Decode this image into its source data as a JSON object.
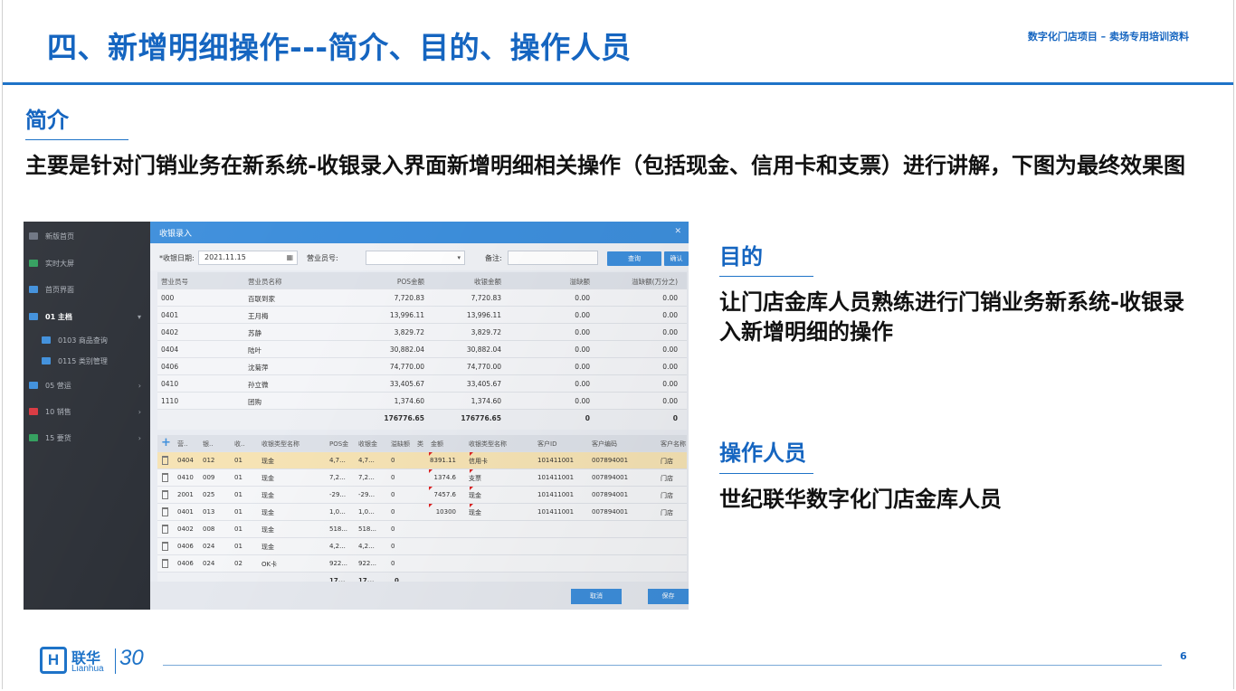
{
  "slide": {
    "title": "四、新增明细操作---简介、目的、操作人员",
    "header_note": "数字化门店项目 – 卖场专用培训资料",
    "page_number": "6"
  },
  "intro": {
    "label": "简介",
    "text": "主要是针对门销业务在新系统-收银录入界面新增明细相关操作（包括现金、信用卡和支票）进行讲解，下图为最终效果图"
  },
  "purpose": {
    "label": "目的",
    "text": "让门店金库人员熟练进行门销业务新系统-收银录入新增明细的操作"
  },
  "operators": {
    "label": "操作人员",
    "text": "世纪联华数字化门店金库人员"
  },
  "app": {
    "sidebar": [
      {
        "label": "新版首页",
        "icon": "home-icon",
        "color": "#6b7280"
      },
      {
        "label": "实时大屏",
        "icon": "screen-icon",
        "color": "#2f9e5b"
      },
      {
        "label": "首页界面",
        "icon": "monitor-icon",
        "color": "#3d8edb"
      },
      {
        "label": "01 主档",
        "icon": "database-icon",
        "color": "#3d8edb",
        "arrow": "▾"
      },
      {
        "label": "0103 商品查询",
        "icon": "search-icon",
        "color": "#3d8edb"
      },
      {
        "label": "0115 类别管理",
        "icon": "grid-icon",
        "color": "#3d8edb"
      },
      {
        "label": "05 营运",
        "icon": "chart-icon",
        "color": "#3d8edb",
        "arrow": "›"
      },
      {
        "label": "10 销售",
        "icon": "cart-icon",
        "color": "#d9363e",
        "arrow": "›"
      },
      {
        "label": "15 要货",
        "icon": "folder-icon",
        "color": "#2f9e5b",
        "arrow": "›"
      }
    ],
    "window_title": "收银录入",
    "filters": {
      "date_label": "*收银日期:",
      "date_value": "2021.11.15",
      "clerk_label": "营业员号:",
      "note_label": "备注:",
      "query_button": "查询",
      "confirm_button": "确认"
    },
    "summary_table": {
      "headers": [
        "营业员号",
        "营业员名称",
        "POS金额",
        "收银金额",
        "溢缺额",
        "溢缺额(万分之)"
      ],
      "rows": [
        [
          "000",
          "百联到家",
          "7,720.83",
          "7,720.83",
          "0.00",
          "0.00"
        ],
        [
          "0401",
          "王月梅",
          "13,996.11",
          "13,996.11",
          "0.00",
          "0.00"
        ],
        [
          "0402",
          "苏静",
          "3,829.72",
          "3,829.72",
          "0.00",
          "0.00"
        ],
        [
          "0404",
          "陆叶",
          "30,882.04",
          "30,882.04",
          "0.00",
          "0.00"
        ],
        [
          "0406",
          "沈菊萍",
          "74,770.00",
          "74,770.00",
          "0.00",
          "0.00"
        ],
        [
          "0410",
          "孙立微",
          "33,405.67",
          "33,405.67",
          "0.00",
          "0.00"
        ],
        [
          "1110",
          "团购",
          "1,374.60",
          "1,374.60",
          "0.00",
          "0.00"
        ]
      ],
      "totals": [
        "176776.65",
        "176776.65",
        "0",
        "0"
      ]
    },
    "detail_left": {
      "headers": [
        "营..",
        "银..",
        "收..",
        "收银类型名称",
        "POS金",
        "收银金",
        "溢缺额"
      ],
      "rows": [
        [
          "0404",
          "012",
          "01",
          "现金",
          "4,7...",
          "4,7...",
          "0"
        ],
        [
          "0410",
          "009",
          "01",
          "现金",
          "7,2...",
          "7,2...",
          "0"
        ],
        [
          "2001",
          "025",
          "01",
          "现金",
          "-29...",
          "-29...",
          "0"
        ],
        [
          "0401",
          "013",
          "01",
          "现金",
          "1,0...",
          "1,0...",
          "0"
        ],
        [
          "0402",
          "008",
          "01",
          "现金",
          "518...",
          "518...",
          "0"
        ],
        [
          "0406",
          "024",
          "01",
          "现金",
          "4,2...",
          "4,2...",
          "0"
        ],
        [
          "0406",
          "024",
          "02",
          "OK卡",
          "922...",
          "922...",
          "0"
        ]
      ],
      "totals": [
        "17...",
        "17...",
        "0"
      ]
    },
    "detail_right": {
      "headers": [
        "类",
        "金额",
        "收银类型名称",
        "客户ID",
        "客户编码",
        "客户名称"
      ],
      "rows": [
        [
          "8391.11",
          "信用卡",
          "101411001",
          "007894001",
          "门店"
        ],
        [
          "1374.6",
          "支票",
          "101411001",
          "007894001",
          "门店"
        ],
        [
          "7457.6",
          "现金",
          "101411001",
          "007894001",
          "门店"
        ],
        [
          "10300",
          "现金",
          "101411001",
          "007894001",
          "门店"
        ]
      ]
    },
    "cancel_button": "取消",
    "save_button": "保存"
  }
}
